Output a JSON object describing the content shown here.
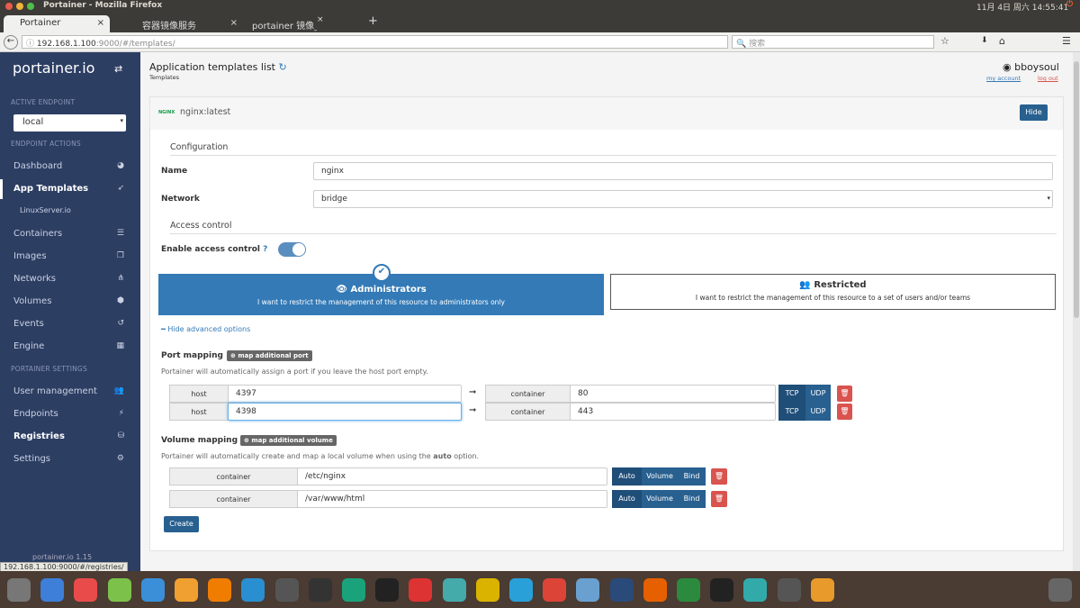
{
  "os": {
    "window_title": "Portainer - Mozilla Firefox",
    "clock": "11月 4日 周六 14:55:41"
  },
  "browser": {
    "tabs": [
      {
        "label": "Portainer"
      },
      {
        "label": "容器镜像服务"
      },
      {
        "label": "portainer 镜像_百度搜"
      }
    ],
    "url_host": "192.168.1.100",
    "url_rest": ":9000/#/templates/",
    "search_placeholder": "搜索",
    "status_url": "192.168.1.100:9000/#/registries/"
  },
  "sidebar": {
    "brand": "portainer.io",
    "active_endpoint_header": "ACTIVE ENDPOINT",
    "endpoint": "local",
    "endpoint_actions_header": "ENDPOINT ACTIONS",
    "settings_header": "PORTAINER SETTINGS",
    "items": [
      {
        "label": "Dashboard"
      },
      {
        "label": "App Templates"
      },
      {
        "label": "LinuxServer.io"
      },
      {
        "label": "Containers"
      },
      {
        "label": "Images"
      },
      {
        "label": "Networks"
      },
      {
        "label": "Volumes"
      },
      {
        "label": "Events"
      },
      {
        "label": "Engine"
      },
      {
        "label": "User management"
      },
      {
        "label": "Endpoints"
      },
      {
        "label": "Registries"
      },
      {
        "label": "Settings"
      }
    ],
    "footer": "portainer.io 1.15"
  },
  "header": {
    "title": "Application templates list",
    "breadcrumb": "Templates",
    "user": "bboysoul",
    "my_account": "my account",
    "log_out": "log out"
  },
  "template": {
    "logo": "NGINX",
    "name": "nginx:latest",
    "hide": "Hide",
    "configuration": "Configuration",
    "name_label": "Name",
    "name_value": "nginx",
    "network_label": "Network",
    "network_value": "bridge",
    "access_control": "Access control",
    "enable_access": "Enable access control",
    "access_enabled": true,
    "admin_title": "Administrators",
    "admin_desc": "I want to restrict the management of this resource to administrators only",
    "restricted_title": "Restricted",
    "restricted_desc": "I want to restrict the management of this resource to a set of users and/or teams",
    "hide_advanced": "Hide advanced options",
    "port_mapping": "Port mapping",
    "map_port": "map additional port",
    "port_note": "Portainer will automatically assign a port if you leave the host port empty.",
    "ports": [
      {
        "host_label": "host",
        "host": "4397",
        "container_label": "container",
        "container": "80",
        "tcp": "TCP",
        "udp": "UDP"
      },
      {
        "host_label": "host",
        "host": "4398",
        "container_label": "container",
        "container": "443",
        "tcp": "TCP",
        "udp": "UDP"
      }
    ],
    "volume_mapping": "Volume mapping",
    "map_volume": "map additional volume",
    "volume_note_a": "Portainer will automatically create and map a local volume when using the ",
    "volume_note_b": "auto",
    "volume_note_c": " option.",
    "volumes": [
      {
        "label": "container",
        "path": "/etc/nginx",
        "auto": "Auto",
        "volume": "Volume",
        "bind": "Bind"
      },
      {
        "label": "container",
        "path": "/var/www/html",
        "auto": "Auto",
        "volume": "Volume",
        "bind": "Bind"
      }
    ],
    "create": "Create"
  },
  "taskbar": {
    "icons": [
      "settings",
      "files",
      "app-red",
      "wechat",
      "feishu",
      "image-viewer",
      "vlc",
      "downloader",
      "sublime",
      "mixer",
      "cleaner",
      "obs",
      "netease-music",
      "monitor",
      "game",
      "telegram",
      "chrome",
      "home-folder",
      "steam",
      "firefox",
      "pycharm",
      "terminal",
      "screenshot",
      "workspaces",
      "installer",
      "trash"
    ],
    "colors": [
      "#777",
      "#3d7fd9",
      "#e94b4b",
      "#7cc24a",
      "#3a8fd8",
      "#f0a030",
      "#f07d00",
      "#2a8fd0",
      "#555",
      "#333",
      "#1aa37a",
      "#222",
      "#d33",
      "#4aa",
      "#d9b300",
      "#2aa0d8",
      "#db4437",
      "#6aa0d0",
      "#2a4a7a",
      "#e66000",
      "#2b8a3e",
      "#222",
      "#3aa",
      "#555",
      "#e89a2a",
      "#666"
    ]
  }
}
